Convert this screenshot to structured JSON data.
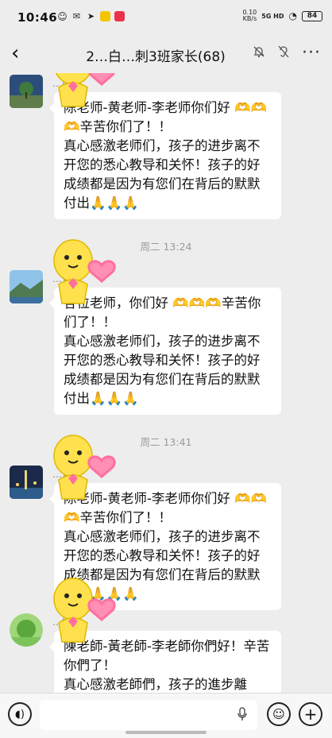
{
  "status": {
    "time": "10:46",
    "net_speed_value": "0.10",
    "net_speed_unit": "KB/s",
    "signal": "5G HD",
    "battery": "84"
  },
  "header": {
    "title": "2…白…刺3班家长(68)",
    "more": "···"
  },
  "messages": [
    {
      "sender": "…妈妈",
      "text": "陈老师-黄老师-李老师你们好 🫶🫶🫶辛苦你们了！！\n真心感激老师们，孩子的进步离不开您的悉心教导和关怀！孩子的好成绩都是因为有您们在背后的默默付出🙏🙏🙏"
    },
    {
      "time": "周二 13:24",
      "sender": "…爸爸",
      "text": "各位老师，你们好 🫶🫶🫶辛苦你们了！！\n真心感激老师们，孩子的进步离不开您的悉心教导和关怀！孩子的好成绩都是因为有您们在背后的默默付出🙏🙏🙏"
    },
    {
      "time": "周二 13:41",
      "sender": "…爸爸",
      "text": "陈老师-黄老师-李老师你们好 🫶🫶🫶辛苦你们了！！\n真心感激老师们，孩子的进步离不开您的悉心教导和关怀！孩子的好成绩都是因为有您们在背后的默默付出🙏🙏🙏"
    },
    {
      "sender": "…媽",
      "text": "陳老師-黃老師-李老師你們好！辛苦你們了！\n真心感激老師們，孩子的進步離"
    }
  ],
  "input": {
    "placeholder": ""
  },
  "colors": {
    "background": "#ededed",
    "bubble": "#ffffff",
    "sticker_yellow": "#ffe14d",
    "heart_pink": "#ff6f9e"
  }
}
